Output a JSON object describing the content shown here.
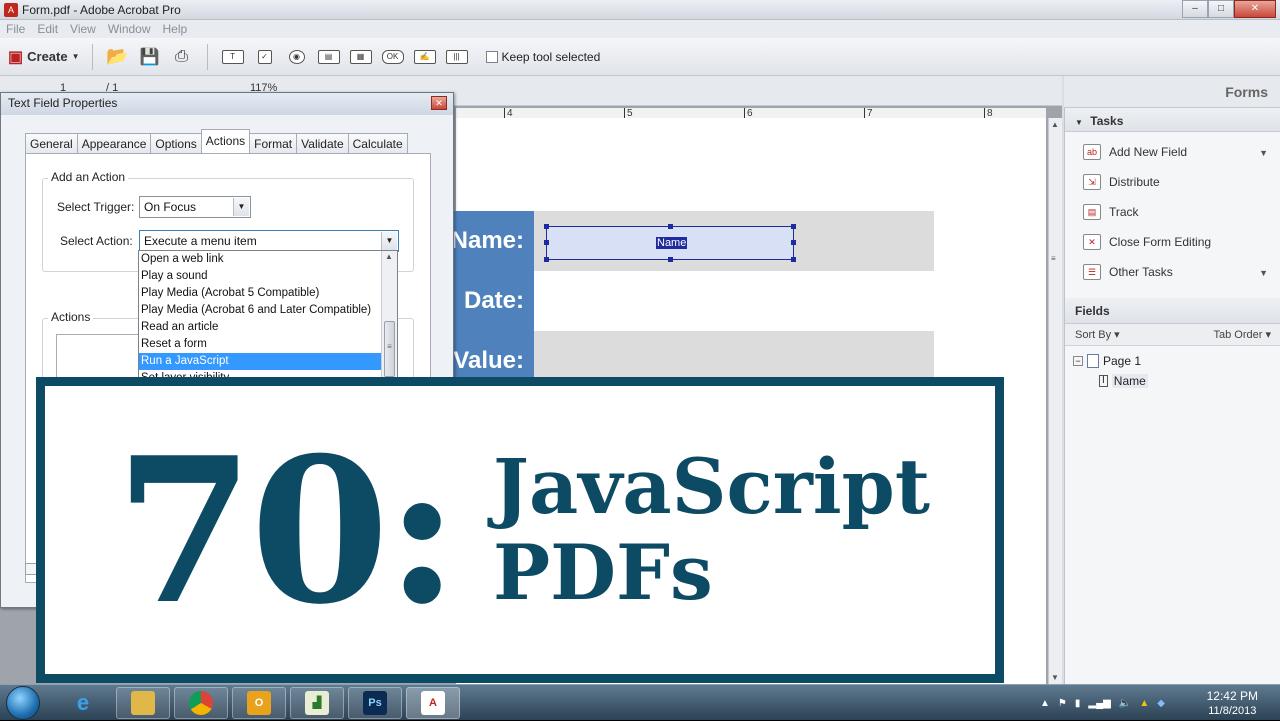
{
  "window": {
    "title": "Form.pdf - Adobe Acrobat Pro"
  },
  "menu": [
    "File",
    "Edit",
    "View",
    "Window",
    "Help"
  ],
  "toolbar": {
    "create_label": "Create",
    "keep_tool_label": "Keep tool selected",
    "field_tools": [
      "T",
      "✓",
      "◉",
      "▤",
      "▦",
      "OK",
      "✍",
      "|||"
    ]
  },
  "nav": {
    "page": "1",
    "total": "/ 1",
    "zoom": "117%"
  },
  "ruler": [
    "4",
    "5",
    "6",
    "7",
    "8"
  ],
  "form": {
    "name_label": "Name:",
    "date_label": "Date:",
    "value_label": "Value:",
    "name_field_text": "Name"
  },
  "right_pane": {
    "header": "Forms",
    "tasks_title": "Tasks",
    "tasks": [
      "Add New Field",
      "Distribute",
      "Track",
      "Close Form Editing",
      "Other Tasks"
    ],
    "fields_title": "Fields",
    "sort_by": "Sort By",
    "tab_order": "Tab Order",
    "tree_page": "Page 1",
    "tree_field": "Name"
  },
  "dialog": {
    "title": "Text Field Properties",
    "tabs": [
      "General",
      "Appearance",
      "Options",
      "Actions",
      "Format",
      "Validate",
      "Calculate"
    ],
    "active_tab": "Actions",
    "add_action_label": "Add an Action",
    "select_trigger_label": "Select Trigger:",
    "trigger_value": "On Focus",
    "select_action_label": "Select Action:",
    "action_value": "Execute a menu item",
    "action_options": [
      "Open a web link",
      "Play a sound",
      "Play Media (Acrobat 5 Compatible)",
      "Play Media (Acrobat 6 and Later Compatible)",
      "Read an article",
      "Reset a form",
      "Run a JavaScript",
      "Set layer visibility"
    ],
    "selected_option": "Run a JavaScript",
    "actions_group_label": "Actions"
  },
  "overlay": {
    "number": "70:",
    "line1": "JavaScript",
    "line2": "PDFs"
  },
  "taskbar": {
    "time": "12:42 PM",
    "date": "11/8/2013"
  },
  "colors": {
    "accent": "#0d4a63",
    "form_label_bg": "#4f81bd",
    "selection": "#3399ff"
  }
}
